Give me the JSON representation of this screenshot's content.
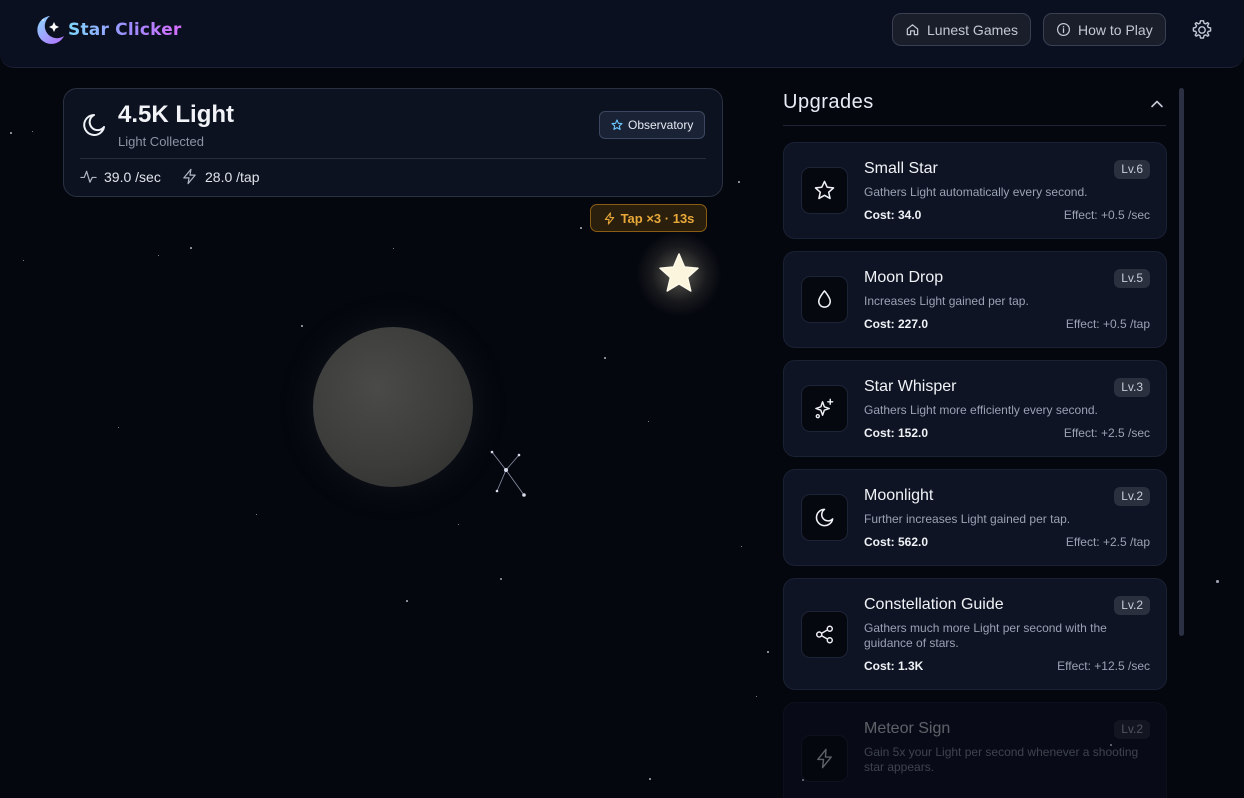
{
  "app": {
    "logo_text": "Star Clicker",
    "nav": [
      {
        "label": "Lunest Games",
        "icon": "home-icon"
      },
      {
        "label": "How to Play",
        "icon": "info-icon"
      }
    ],
    "settings_icon": "gear-icon"
  },
  "light": {
    "amount": "4.5K Light",
    "subtitle": "Light Collected",
    "observatory_label": "Observatory",
    "per_sec": "39.0 /sec",
    "per_tap": "28.0 /tap"
  },
  "boost": {
    "label": "Tap ×3 · 13s"
  },
  "upgrades": {
    "title": "Upgrades",
    "items": [
      {
        "name": "Small Star",
        "level": "Lv.6",
        "desc": "Gathers Light automatically every second.",
        "cost": "Cost: 34.0",
        "effect": "Effect: +0.5 /sec",
        "icon": "star-icon",
        "enabled": true
      },
      {
        "name": "Moon Drop",
        "level": "Lv.5",
        "desc": "Increases Light gained per tap.",
        "cost": "Cost: 227.0",
        "effect": "Effect: +0.5 /tap",
        "icon": "droplet-icon",
        "enabled": true
      },
      {
        "name": "Star Whisper",
        "level": "Lv.3",
        "desc": "Gathers Light more efficiently every second.",
        "cost": "Cost: 152.0",
        "effect": "Effect: +2.5 /sec",
        "icon": "sparkles-icon",
        "enabled": true
      },
      {
        "name": "Moonlight",
        "level": "Lv.2",
        "desc": "Further increases Light gained per tap.",
        "cost": "Cost: 562.0",
        "effect": "Effect: +2.5 /tap",
        "icon": "moon-icon",
        "enabled": true
      },
      {
        "name": "Constellation Guide",
        "level": "Lv.2",
        "desc": "Gathers much more Light per second with the guidance of stars.",
        "cost": "Cost: 1.3K",
        "effect": "Effect: +12.5 /sec",
        "icon": "share-nodes-icon",
        "enabled": true
      },
      {
        "name": "Meteor Sign",
        "level": "Lv.2",
        "desc": "Gain 5x your Light per second whenever a shooting star appears.",
        "cost": "",
        "effect": "",
        "icon": "lightning-icon",
        "enabled": false
      }
    ]
  },
  "colors": {
    "background": "#05070f",
    "card": "#0e1424",
    "boost_accent": "#e8a83a",
    "logo_gradient": [
      "#7fd8ff",
      "#9f8bff",
      "#d86cff"
    ]
  }
}
